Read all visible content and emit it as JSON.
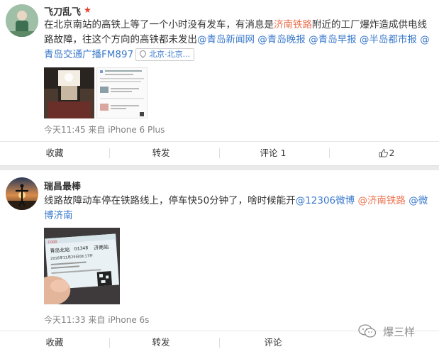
{
  "post1": {
    "username": "飞刀乱飞",
    "text_1": "在北京南站的高铁上等了一个小时没有发车，有消息是",
    "link_jinan_railway": "济南铁路",
    "text_2": "附近的工厂爆炸造成供电线路故障，往这个方向的高铁都未发出",
    "mentions": [
      "@青岛新闻网",
      "@青岛晚报",
      "@青岛早报",
      "@半岛都市报",
      "@青岛交通广播FM897"
    ],
    "location": "北京·北京...",
    "meta": "今天11:45 来自 iPhone 6 Plus",
    "actions": {
      "favorite": "收藏",
      "repost": "转发",
      "comment": "评论 1",
      "like": "2"
    }
  },
  "post2": {
    "username": "瑞昌最棒",
    "text_1": "线路故障动车停在铁路线上，停车快50分钟了，啥时候能开",
    "mentions": [
      "@12306微博",
      "@济南铁路",
      "@微博济南"
    ],
    "ticket": {
      "train": "G1348",
      "from": "青岛北站",
      "to": "济南站",
      "date": "2016年11月29日08:17开"
    },
    "meta": "今天11:33 来自 iPhone 6s",
    "actions": {
      "favorite": "收藏",
      "repost": "转发",
      "comment": "评论"
    }
  },
  "watermark": "爆三样",
  "colors": {
    "link_orange": "#eb7350",
    "link_blue": "#3b7acc",
    "meta_gray": "#808080",
    "vip_red": "#e8412c"
  }
}
